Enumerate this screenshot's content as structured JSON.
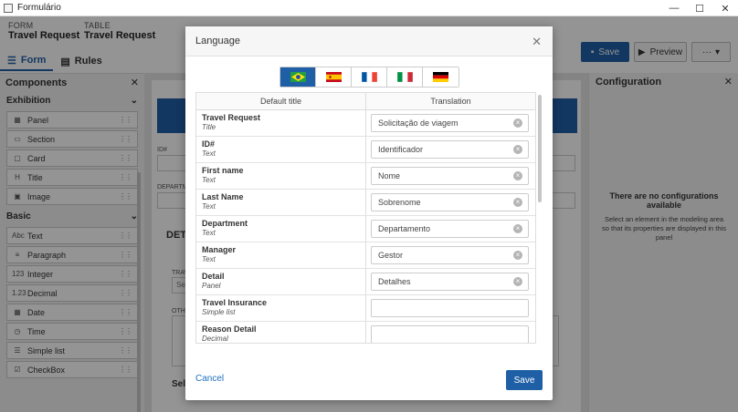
{
  "window": {
    "title": "Formulário",
    "controls": [
      "—",
      "☐",
      "✕"
    ]
  },
  "header": {
    "form_label": "FORM",
    "form_name": "Travel Request",
    "table_label": "TABLE",
    "table_name": "Travel Request"
  },
  "tabs": [
    {
      "label": "Form",
      "icon": "list-icon"
    },
    {
      "label": "Rules",
      "icon": "document-icon"
    }
  ],
  "toolbar": {
    "save_label": "Save",
    "preview_label": "Preview",
    "more_label": "···"
  },
  "components": {
    "title": "Components",
    "sections": [
      {
        "title": "Exhibition",
        "items": [
          {
            "label": "Panel",
            "glyph": "▦"
          },
          {
            "label": "Section",
            "glyph": "▭"
          },
          {
            "label": "Card",
            "glyph": "▢"
          },
          {
            "label": "Title",
            "glyph": "H"
          },
          {
            "label": "Image",
            "glyph": "▣"
          }
        ]
      },
      {
        "title": "Basic",
        "items": [
          {
            "label": "Text",
            "glyph": "Abc"
          },
          {
            "label": "Paragraph",
            "glyph": "≡"
          },
          {
            "label": "Integer",
            "glyph": "123"
          },
          {
            "label": "Decimal",
            "glyph": "1.23"
          },
          {
            "label": "Date",
            "glyph": "▦"
          },
          {
            "label": "Time",
            "glyph": "◷"
          },
          {
            "label": "Simple list",
            "glyph": "☰"
          },
          {
            "label": "CheckBox",
            "glyph": "☑"
          }
        ]
      }
    ]
  },
  "canvas": {
    "id_label": "ID#",
    "dept_label": "DEPARTM",
    "detail_heading": "DET",
    "trav_label": "TRAV",
    "trav_value": "Se",
    "other_label": "OTH",
    "sel_heading": "Sel"
  },
  "configuration": {
    "title": "Configuration",
    "empty_title": "There are no configurations available",
    "empty_desc": "Select an element in the modeling area so that its properties are displayed in this panel"
  },
  "modal": {
    "title": "Language",
    "flags": [
      {
        "lang": "Portuguese (Brazil)",
        "active": true
      },
      {
        "lang": "Spanish",
        "active": false
      },
      {
        "lang": "French",
        "active": false
      },
      {
        "lang": "Italian",
        "active": false
      },
      {
        "lang": "German",
        "active": false
      }
    ],
    "col_default": "Default title",
    "col_translation": "Translation",
    "rows": [
      {
        "name": "Travel Request",
        "type": "Title",
        "translation": "Solicitação de viagem"
      },
      {
        "name": "ID#",
        "type": "Text",
        "translation": "Identificador"
      },
      {
        "name": "First name",
        "type": "Text",
        "translation": "Nome"
      },
      {
        "name": "Last Name",
        "type": "Text",
        "translation": "Sobrenome"
      },
      {
        "name": "Department",
        "type": "Text",
        "translation": "Departamento"
      },
      {
        "name": "Manager",
        "type": "Text",
        "translation": "Gestor"
      },
      {
        "name": "Detail",
        "type": "Panel",
        "translation": "Detalhes"
      },
      {
        "name": "Travel Insurance",
        "type": "Simple list",
        "translation": ""
      },
      {
        "name": "Reason Detail",
        "type": "Decimal",
        "translation": ""
      }
    ],
    "cancel_label": "Cancel",
    "save_label": "Save"
  }
}
